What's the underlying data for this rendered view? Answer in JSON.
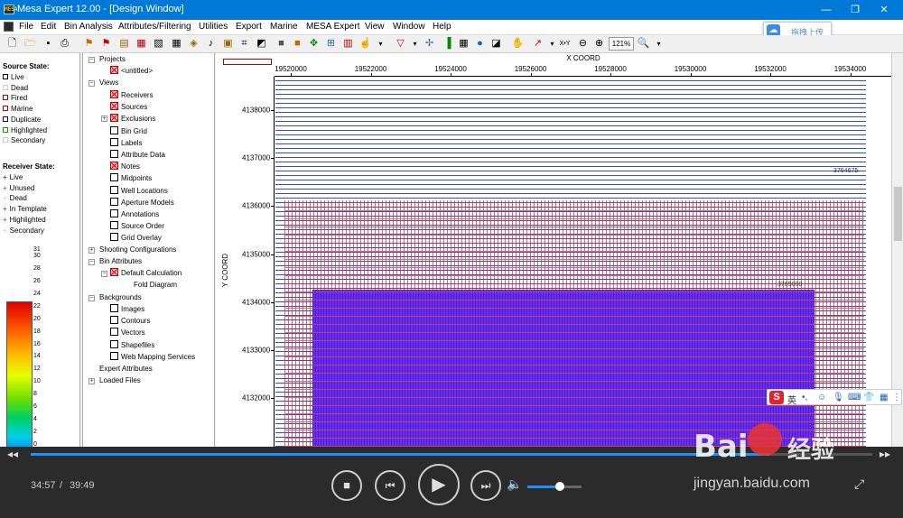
{
  "window": {
    "title": "Mesa Expert 12.00 - [Design Window]",
    "app_icon": "MESA"
  },
  "menu": [
    "File",
    "Edit",
    "Bin Analysis",
    "Attributes/Filtering",
    "Utilities",
    "Export",
    "Marine",
    "MESA Expert",
    "View",
    "Window",
    "Help"
  ],
  "cloud_upload": {
    "label": "拖拽上传"
  },
  "toolbar": {
    "zoom": "121%"
  },
  "legend": {
    "source_title": "Source State:",
    "source_items": [
      {
        "label": "Live",
        "color": "#000000"
      },
      {
        "label": "Dead",
        "color": "#cccccc"
      },
      {
        "label": "Fired",
        "color": "#c00000"
      },
      {
        "label": "Marine",
        "color": "#c00000"
      },
      {
        "label": "Duplicate",
        "color": "#0000c0"
      },
      {
        "label": "Highlighted",
        "color": "#00a000"
      },
      {
        "label": "Secondary",
        "color": "#cccccc"
      }
    ],
    "receiver_title": "Receiver State:",
    "receiver_items": [
      {
        "label": "Live",
        "color": "#0000c0"
      },
      {
        "label": "Unused",
        "color": "#00a000"
      },
      {
        "label": "Dead",
        "color": "#cccccc"
      },
      {
        "label": "In Template",
        "color": "#c00000"
      },
      {
        "label": "Highlighted",
        "color": "#00a000"
      },
      {
        "label": "Secondary",
        "color": "#cccccc"
      }
    ],
    "colorbar_ticks": [
      "31",
      "30",
      "28",
      "26",
      "24",
      "22",
      "20",
      "18",
      "16",
      "14",
      "12",
      "10",
      "8",
      "6",
      "4",
      "2",
      "0"
    ]
  },
  "tree": {
    "projects": "Projects",
    "untitled": "<untitled>",
    "views": "Views",
    "view_items": [
      {
        "label": "Receivers",
        "checked": true
      },
      {
        "label": "Sources",
        "checked": true
      },
      {
        "label": "Exclusions",
        "checked": true
      },
      {
        "label": "Bin Grid",
        "checked": false
      },
      {
        "label": "Labels",
        "checked": false
      },
      {
        "label": "Attribute Data",
        "checked": false
      },
      {
        "label": "Notes",
        "checked": true
      },
      {
        "label": "Midpoints",
        "checked": false
      },
      {
        "label": "Well Locations",
        "checked": false
      },
      {
        "label": "Aperture Models",
        "checked": false
      },
      {
        "label": "Annotations",
        "checked": false
      },
      {
        "label": "Source Order",
        "checked": false
      },
      {
        "label": "Grid Overlay",
        "checked": false
      }
    ],
    "shooting": "Shooting Configurations",
    "bin_attributes": "Bin Attributes",
    "default_calc": "Default Calculation",
    "fold_diagram": "Fold Diagram",
    "backgrounds": "Backgrounds",
    "bg_items": [
      "Images",
      "Contours",
      "Vectors",
      "Shapefiles",
      "Web Mapping Services"
    ],
    "expert_attributes": "Expert Attributes",
    "loaded_files": "Loaded Files"
  },
  "map": {
    "x_title": "X COORD",
    "y_title": "Y COORD",
    "x_ticks": [
      "19520000",
      "19522000",
      "19524000",
      "19526000",
      "19528000",
      "19530000",
      "19532000",
      "19534000"
    ],
    "y_ticks": [
      "4138000",
      "4137000",
      "4136000",
      "4135000",
      "4134000",
      "4133000",
      "4132000"
    ],
    "note1": "3764675",
    "note2": "3765000"
  },
  "ime": {
    "mode": "英"
  },
  "player": {
    "current": "34:57",
    "separator": "/",
    "total": "39:49",
    "progress": 0.878,
    "volume": 0.6
  },
  "watermark": {
    "brand": "Bai",
    "brand2": "经验",
    "url": "jingyan.baidu.com"
  }
}
